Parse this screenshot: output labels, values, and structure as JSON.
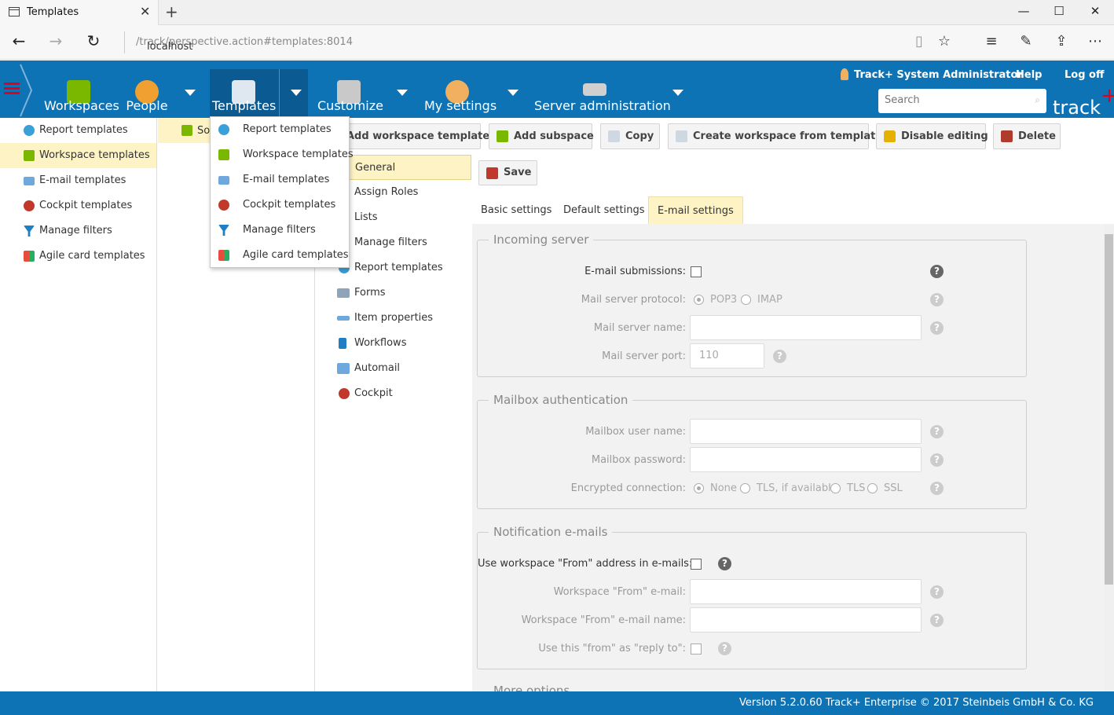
{
  "browser": {
    "tab_title": "Templates",
    "url_host": "localhost",
    "url_path": "/track/perspective.action#templates:8014"
  },
  "header": {
    "nav": [
      {
        "label": "Workspaces",
        "icon": "workspaces-icon"
      },
      {
        "label": "People",
        "icon": "people-icon"
      },
      {
        "label": "Templates",
        "icon": "templates-icon"
      },
      {
        "label": "Customize",
        "icon": "customize-icon"
      },
      {
        "label": "My settings",
        "icon": "my-settings-icon"
      },
      {
        "label": "Server administration",
        "icon": "server-admin-icon"
      }
    ],
    "user": "Track+ System Administrator",
    "help": "Help",
    "logoff": "Log off",
    "search_placeholder": "Search",
    "brand": "track",
    "brand_plus": "+"
  },
  "left_tree": [
    {
      "label": "Report templates",
      "color": "#3aa0d8"
    },
    {
      "label": "Workspace templates",
      "color": "#7ab800"
    },
    {
      "label": "E-mail templates",
      "color": "#6fa8dc"
    },
    {
      "label": "Cockpit templates",
      "color": "#c0392b"
    },
    {
      "label": "Manage filters",
      "color": "#1f7fc4"
    },
    {
      "label": "Agile card templates",
      "color": "#e67e22"
    }
  ],
  "mid_panel": {
    "selected_label": "So"
  },
  "dropdown": [
    {
      "label": "Report templates",
      "color": "#3aa0d8"
    },
    {
      "label": "Workspace templates",
      "color": "#7ab800"
    },
    {
      "label": "E-mail templates",
      "color": "#6fa8dc"
    },
    {
      "label": "Cockpit templates",
      "color": "#c0392b"
    },
    {
      "label": "Manage filters",
      "color": "#1f7fc4"
    },
    {
      "label": "Agile card templates",
      "color": "#e67e22"
    }
  ],
  "toolbar": {
    "add_workspace_template": "Add workspace template",
    "add_subspace": "Add subspace",
    "copy": "Copy",
    "create_from_template": "Create workspace from template",
    "disable_editing": "Disable editing",
    "delete": "Delete"
  },
  "nav_list": [
    {
      "label": "General"
    },
    {
      "label": "Assign Roles"
    },
    {
      "label": "Lists"
    },
    {
      "label": "Manage filters"
    },
    {
      "label": "Report templates"
    },
    {
      "label": "Forms"
    },
    {
      "label": "Item properties"
    },
    {
      "label": "Workflows"
    },
    {
      "label": "Automail"
    },
    {
      "label": "Cockpit"
    }
  ],
  "content": {
    "save": "Save",
    "tabs": [
      "Basic settings",
      "Default settings",
      "E-mail settings"
    ],
    "incoming": {
      "legend": "Incoming server",
      "email_submissions": "E-mail submissions:",
      "protocol_label": "Mail server protocol:",
      "pop3": "POP3",
      "imap": "IMAP",
      "server_name": "Mail server name:",
      "server_port": "Mail server port:",
      "port_value": "110"
    },
    "auth": {
      "legend": "Mailbox authentication",
      "user_name": "Mailbox user name:",
      "password": "Mailbox password:",
      "encrypted": "Encrypted connection:",
      "none": "None",
      "tls_avail": "TLS, if available",
      "tls": "TLS",
      "ssl": "SSL"
    },
    "notif": {
      "legend": "Notification e-mails",
      "use_from": "Use workspace \"From\" address in e-mails:",
      "from_email": "Workspace \"From\" e-mail:",
      "from_name": "Workspace \"From\" e-mail name:",
      "reply_to": "Use this \"from\" as \"reply to\":"
    },
    "more": "More options"
  },
  "footer": "Version 5.2.0.60 Track+ Enterprise  © 2017 Steinbeis GmbH & Co. KG"
}
